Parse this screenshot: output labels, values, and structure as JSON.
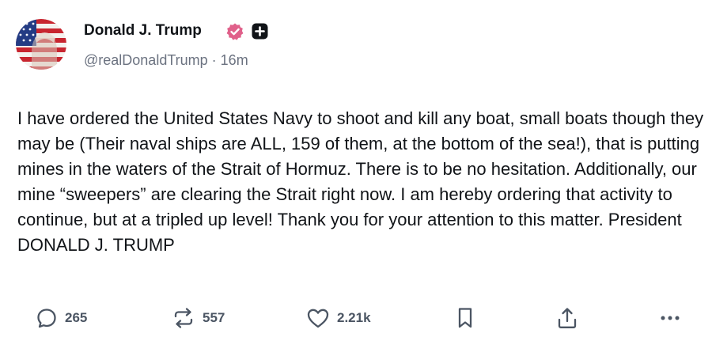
{
  "post": {
    "author": {
      "display_name": "Donald J. Trump",
      "handle": "@realDonaldTrump",
      "separator": " · ",
      "time_ago": "16m"
    },
    "body": "I have ordered the United States Navy to shoot and kill any boat, small boats though they may be (Their naval ships are ALL, 159 of them, at the bottom of the sea!), that is putting mines in the waters of the Strait of Hormuz. There is to be no hesitation. Additionally, our mine “sweepers” are clearing the Strait right now. I am hereby ordering that activity to continue, but at a tripled up level! Thank you for your attention to this matter. President DONALD J. TRUMP",
    "actions": {
      "replies": "265",
      "reposts": "557",
      "likes": "2.21k"
    }
  },
  "icons": {
    "verified": "verified-badge-icon",
    "plus": "plus-square-icon",
    "reply": "chat-bubble-icon",
    "repost": "repost-arrows-icon",
    "like": "heart-icon",
    "bookmark": "bookmark-icon",
    "share": "share-upload-icon",
    "more": "more-horizontal-icon"
  },
  "colors": {
    "verified_badge": "#e0608a",
    "text_primary": "#111418",
    "text_secondary": "#6b7280",
    "icon": "#4b5563"
  }
}
